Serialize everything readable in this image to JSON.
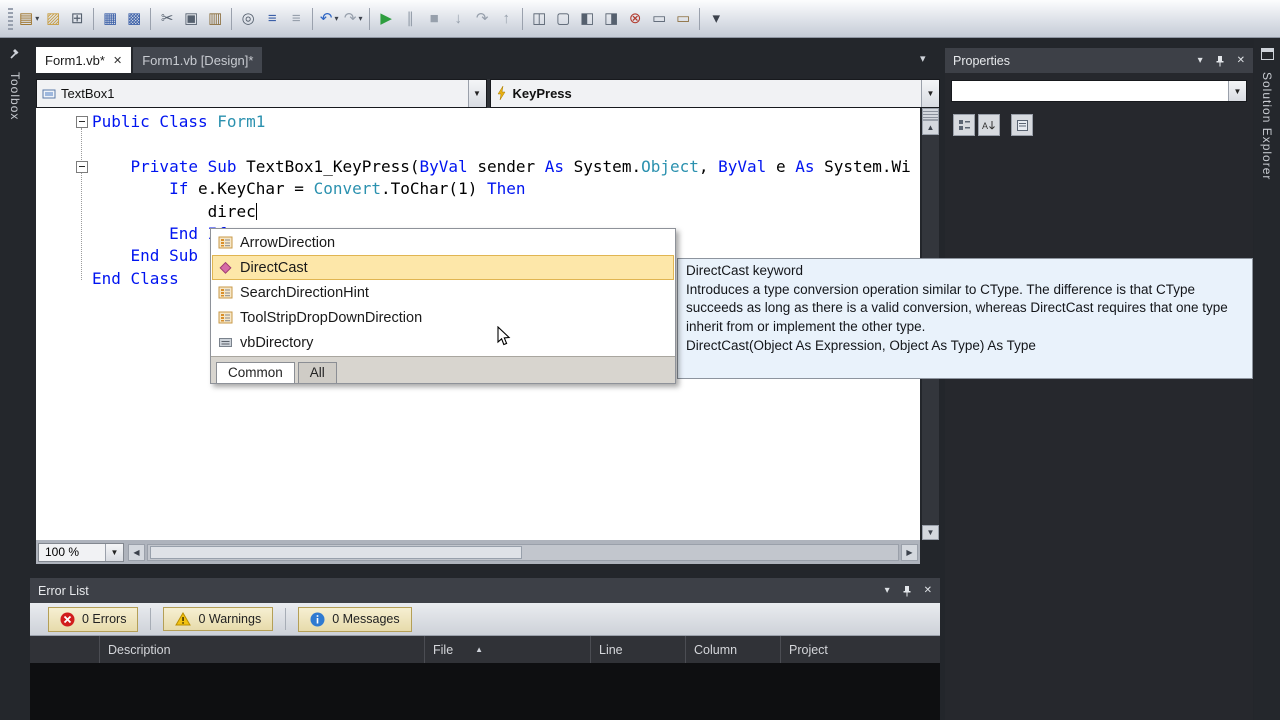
{
  "glyphs": {
    "chevron": "▾",
    "dropdown": "▼",
    "close": "✕",
    "up": "▲",
    "down": "▼",
    "left": "◀",
    "right": "▶",
    "sort_asc": "▲"
  },
  "toolbar": {
    "items": [
      {
        "name": "add-item-icon",
        "glyph": "▤",
        "color": "#9a6d1f",
        "dropdown": true
      },
      {
        "name": "open-file-icon",
        "glyph": "▨",
        "color": "#c79b3b"
      },
      {
        "name": "add-new-project-icon",
        "glyph": "⊞",
        "color": "#55606e"
      },
      {
        "sep": true
      },
      {
        "name": "save-icon",
        "glyph": "▦",
        "color": "#3a5fa8"
      },
      {
        "name": "save-all-icon",
        "glyph": "▩",
        "color": "#3a5fa8"
      },
      {
        "sep": true
      },
      {
        "name": "cut-icon",
        "glyph": "✂",
        "color": "#55606e"
      },
      {
        "name": "copy-icon",
        "glyph": "▣",
        "color": "#55606e"
      },
      {
        "name": "paste-icon",
        "glyph": "▥",
        "color": "#8a6d3b"
      },
      {
        "sep": true
      },
      {
        "name": "find-icon",
        "glyph": "◎",
        "color": "#55606e"
      },
      {
        "name": "comment-icon",
        "glyph": "≡",
        "color": "#3a5fa8"
      },
      {
        "name": "uncomment-icon",
        "glyph": "≡",
        "color": "#97a0ac"
      },
      {
        "sep": true
      },
      {
        "name": "undo-icon",
        "glyph": "↶",
        "color": "#2f66c4",
        "dropdown": true
      },
      {
        "name": "redo-icon",
        "glyph": "↷",
        "color": "#97a0ac",
        "dropdown": true
      },
      {
        "sep": true
      },
      {
        "name": "start-debugging-icon",
        "glyph": "▶",
        "color": "#2e9e3f"
      },
      {
        "name": "break-all-icon",
        "glyph": "∥",
        "color": "#97a0ac"
      },
      {
        "name": "stop-debugging-icon",
        "glyph": "■",
        "color": "#97a0ac"
      },
      {
        "name": "step-into-icon",
        "glyph": "↓",
        "color": "#97a0ac"
      },
      {
        "name": "step-over-icon",
        "glyph": "↷",
        "color": "#97a0ac"
      },
      {
        "name": "step-out-icon",
        "glyph": "↑",
        "color": "#97a0ac"
      },
      {
        "sep": true
      },
      {
        "name": "solution-explorer-icon",
        "glyph": "◫",
        "color": "#55606e"
      },
      {
        "name": "properties-window-icon",
        "glyph": "▢",
        "color": "#55606e"
      },
      {
        "name": "object-browser-icon",
        "glyph": "◧",
        "color": "#55606e"
      },
      {
        "name": "toolbox-window-icon",
        "glyph": "◨",
        "color": "#55606e"
      },
      {
        "name": "error-list-window-icon",
        "glyph": "⊗",
        "color": "#b23b2e"
      },
      {
        "name": "immediate-window-icon",
        "glyph": "▭",
        "color": "#55606e"
      },
      {
        "name": "command-window-icon",
        "glyph": "▭",
        "color": "#8a6d3b"
      },
      {
        "sep": true
      },
      {
        "name": "toolbar-overflow-icon",
        "glyph": "▾",
        "color": "#3c424c"
      }
    ]
  },
  "rails": {
    "left": "Toolbox",
    "right": "Solution Explorer"
  },
  "doc_tabs": [
    {
      "label": "Form1.vb*",
      "active": true,
      "closable": true
    },
    {
      "label": "Form1.vb [Design]*",
      "active": false
    }
  ],
  "navbar": {
    "object_combo": {
      "label": "TextBox1",
      "icon": "object-icon"
    },
    "event_combo": {
      "label": "KeyPress",
      "icon": "event-icon"
    }
  },
  "editor": {
    "zoom": "100 %",
    "lines": [
      {
        "fold": true,
        "tokens": [
          {
            "c": "kw",
            "t": "Public Class "
          },
          {
            "c": "ty",
            "t": "Form1"
          }
        ]
      },
      {
        "tokens": []
      },
      {
        "fold": true,
        "tokens": [
          {
            "c": "pl",
            "t": "    "
          },
          {
            "c": "kw",
            "t": "Private Sub "
          },
          {
            "c": "pl",
            "t": "TextBox1_KeyPress("
          },
          {
            "c": "kw",
            "t": "ByVal"
          },
          {
            "c": "pl",
            "t": " sender "
          },
          {
            "c": "kw",
            "t": "As"
          },
          {
            "c": "pl",
            "t": " System."
          },
          {
            "c": "ty",
            "t": "Object"
          },
          {
            "c": "pl",
            "t": ", "
          },
          {
            "c": "kw",
            "t": "ByVal"
          },
          {
            "c": "pl",
            "t": " e "
          },
          {
            "c": "kw",
            "t": "As"
          },
          {
            "c": "pl",
            "t": " System.Wi"
          }
        ]
      },
      {
        "tokens": [
          {
            "c": "pl",
            "t": "        "
          },
          {
            "c": "kw",
            "t": "If"
          },
          {
            "c": "pl",
            "t": " e.KeyChar = "
          },
          {
            "c": "ty",
            "t": "Convert"
          },
          {
            "c": "pl",
            "t": ".ToChar(1) "
          },
          {
            "c": "kw",
            "t": "Then"
          }
        ]
      },
      {
        "caret": true,
        "tokens": [
          {
            "c": "pl",
            "t": "            direc"
          }
        ]
      },
      {
        "tokens": [
          {
            "c": "pl",
            "t": "        "
          },
          {
            "c": "kw",
            "t": "End If"
          }
        ]
      },
      {
        "tokens": [
          {
            "c": "pl",
            "t": "    "
          },
          {
            "c": "kw",
            "t": "End Sub"
          }
        ]
      },
      {
        "tokens": [
          {
            "c": "kw",
            "t": "End Class"
          }
        ]
      }
    ]
  },
  "intellisense": {
    "items": [
      {
        "label": "ArrowDirection",
        "icon": "enum-icon"
      },
      {
        "label": "DirectCast",
        "icon": "keyword-icon",
        "selected": true
      },
      {
        "label": "SearchDirectionHint",
        "icon": "enum-icon"
      },
      {
        "label": "ToolStripDropDownDirection",
        "icon": "enum-icon"
      },
      {
        "label": "vbDirectory",
        "icon": "constant-icon"
      }
    ],
    "filter_tabs": [
      {
        "label": "Common",
        "active": true
      },
      {
        "label": "All",
        "active": false
      }
    ]
  },
  "tooltip": {
    "title": "DirectCast keyword",
    "body": "Introduces a type conversion operation similar to CType. The difference is that CType succeeds as long as there is a valid conversion, whereas DirectCast requires that one type inherit from or implement the other type.",
    "signature": "DirectCast(Object As Expression, Object As Type) As Type"
  },
  "error_list": {
    "title": "Error List",
    "filters": [
      {
        "label": "0 Errors",
        "icon": "error-icon"
      },
      {
        "label": "0 Warnings",
        "icon": "warning-icon"
      },
      {
        "label": "0 Messages",
        "icon": "message-icon"
      }
    ],
    "columns": [
      {
        "label": ""
      },
      {
        "label": "Description"
      },
      {
        "label": "File",
        "sort": "asc"
      },
      {
        "label": "Line"
      },
      {
        "label": "Column"
      },
      {
        "label": "Project"
      }
    ]
  },
  "properties": {
    "title": "Properties",
    "selected_object": "",
    "tools": [
      "categorized-icon",
      "alphabetical-icon",
      "property-pages-icon"
    ]
  }
}
